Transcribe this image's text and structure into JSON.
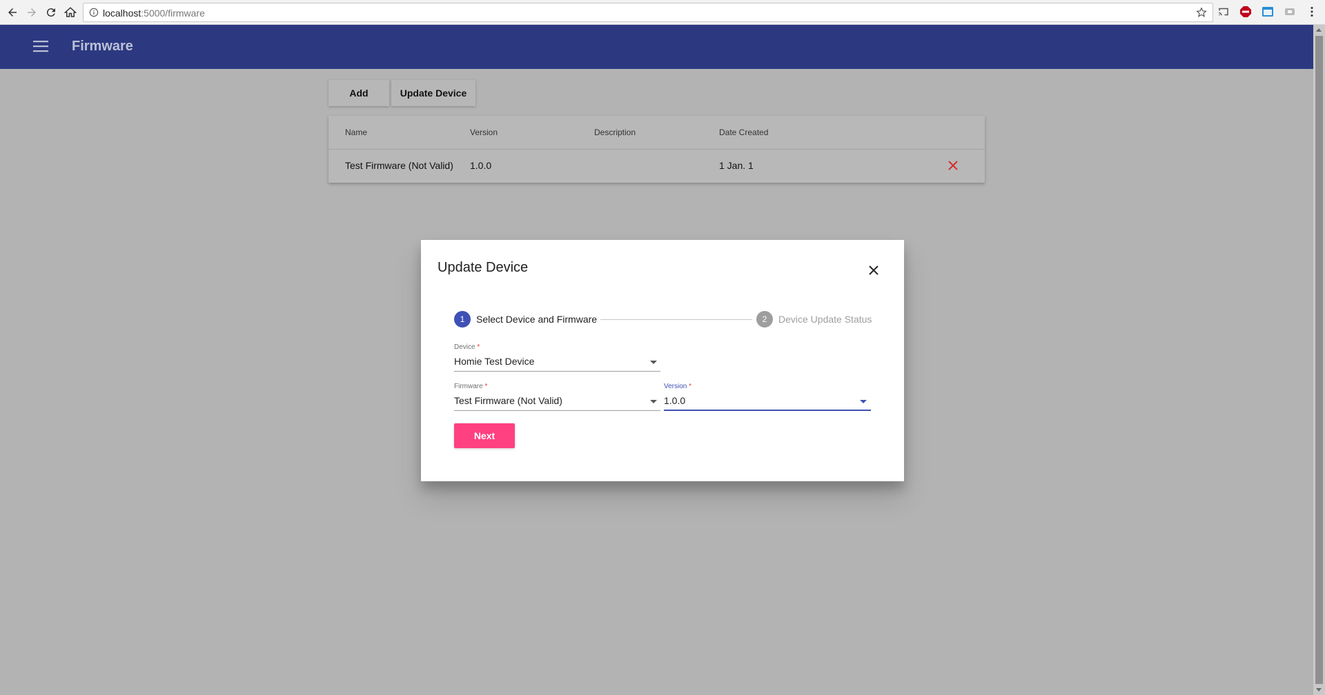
{
  "browser": {
    "url_host": "localhost",
    "url_path": ":5000/firmware"
  },
  "appbar": {
    "title": "Firmware"
  },
  "toolbar": {
    "add_label": "Add",
    "update_label": "Update Device"
  },
  "table": {
    "headers": [
      "Name",
      "Version",
      "Description",
      "Date Created"
    ],
    "rows": [
      {
        "name": "Test Firmware (Not Valid)",
        "version": "1.0.0",
        "description": "",
        "date_created": "1 Jan. 1"
      }
    ]
  },
  "dialog": {
    "title": "Update Device",
    "steps": [
      {
        "number": "1",
        "label": "Select Device and Firmware",
        "active": true
      },
      {
        "number": "2",
        "label": "Device Update Status",
        "active": false
      }
    ],
    "device": {
      "label": "Device",
      "required_mark": " *",
      "value": "Homie Test Device"
    },
    "firmware": {
      "label": "Firmware",
      "required_mark": " *",
      "value": "Test Firmware (Not Valid)"
    },
    "version": {
      "label": "Version",
      "required_mark": " *",
      "value": "1.0.0"
    },
    "next_label": "Next"
  },
  "colors": {
    "primary": "#2c3981",
    "accent": "#ff4081",
    "step_active": "#3f51b5",
    "step_inactive": "#9e9e9e",
    "delete": "#e53935"
  }
}
